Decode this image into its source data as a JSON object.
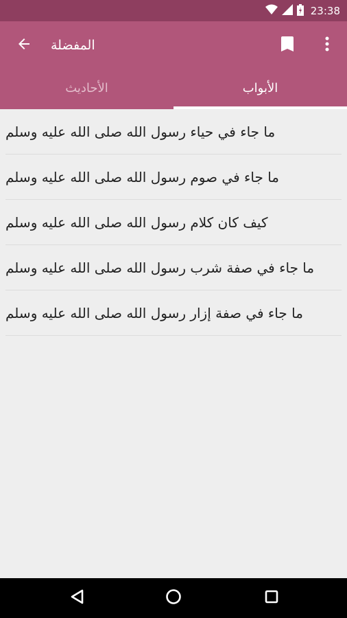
{
  "status_bar": {
    "time": "23:38"
  },
  "app_bar": {
    "title": "المفضلة"
  },
  "tabs": [
    {
      "label": "الأحاديث",
      "active": false
    },
    {
      "label": "الأبواب",
      "active": true
    }
  ],
  "list": {
    "items": [
      {
        "text": "ما جاء في حياء رسول الله صلى الله عليه وسلم"
      },
      {
        "text": "ما جاء في صوم رسول الله صلى الله عليه وسلم"
      },
      {
        "text": "كيف كان كلام رسول الله صلى الله عليه وسلم"
      },
      {
        "text": "ما جاء في صفة شرب رسول الله صلى الله عليه وسلم"
      },
      {
        "text": "ما جاء في صفة إزار رسول الله صلى الله عليه وسلم"
      }
    ]
  },
  "colors": {
    "primary": "#b1567a",
    "primary_dark": "#8e3e5f",
    "background": "#eeeeee"
  },
  "icons": [
    "wifi-icon",
    "signal-icon",
    "battery-icon",
    "back-arrow-icon",
    "bookmark-icon",
    "more-vert-icon",
    "nav-back-icon",
    "nav-home-icon",
    "nav-recent-icon"
  ]
}
